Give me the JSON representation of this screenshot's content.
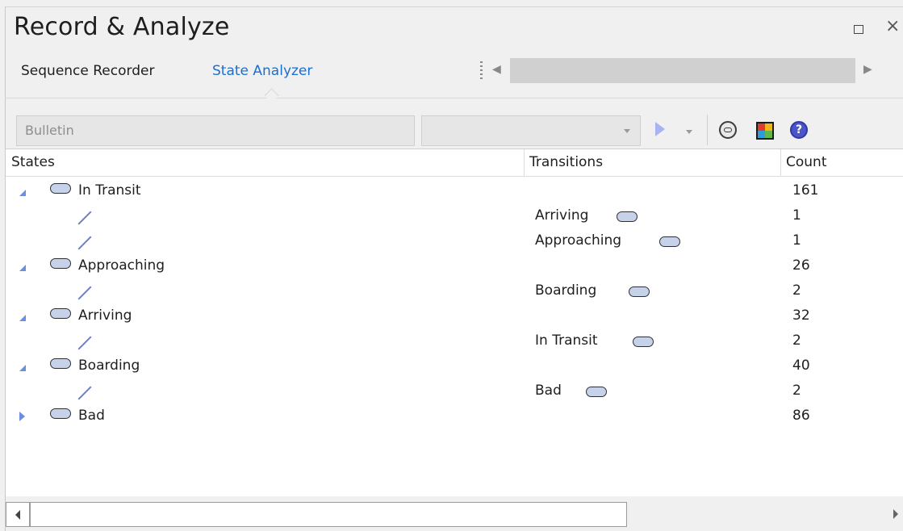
{
  "window": {
    "title": "Record & Analyze"
  },
  "tabs": [
    {
      "label": "Sequence Recorder",
      "active": false
    },
    {
      "label": "State Analyzer",
      "active": true
    }
  ],
  "toolbar": {
    "classifier_value": "Bulletin",
    "second_combo_value": "",
    "icons": [
      "play-icon",
      "play-dropdown-icon",
      "record-icon",
      "layout-icon",
      "help-icon"
    ]
  },
  "columns": {
    "states": "States",
    "transitions": "Transitions",
    "count": "Count"
  },
  "rows": [
    {
      "type": "state",
      "expanded": true,
      "name": "In Transit",
      "count": "161"
    },
    {
      "type": "transition",
      "target": "Arriving",
      "count": "1"
    },
    {
      "type": "transition",
      "target": "Approaching",
      "count": "1"
    },
    {
      "type": "state",
      "expanded": true,
      "name": "Approaching",
      "count": "26"
    },
    {
      "type": "transition",
      "target": "Boarding",
      "count": "2"
    },
    {
      "type": "state",
      "expanded": true,
      "name": "Arriving",
      "count": "32"
    },
    {
      "type": "transition",
      "target": "In Transit",
      "count": "2"
    },
    {
      "type": "state",
      "expanded": true,
      "name": "Boarding",
      "count": "40"
    },
    {
      "type": "transition",
      "target": "Bad",
      "count": "2"
    },
    {
      "type": "state",
      "expanded": false,
      "name": "Bad",
      "count": "86"
    }
  ],
  "colors": {
    "accent": "#1a6fd1",
    "state_fill": "#c5d2ea",
    "expander": "#6b8ee0",
    "help": "#4b55c8"
  }
}
